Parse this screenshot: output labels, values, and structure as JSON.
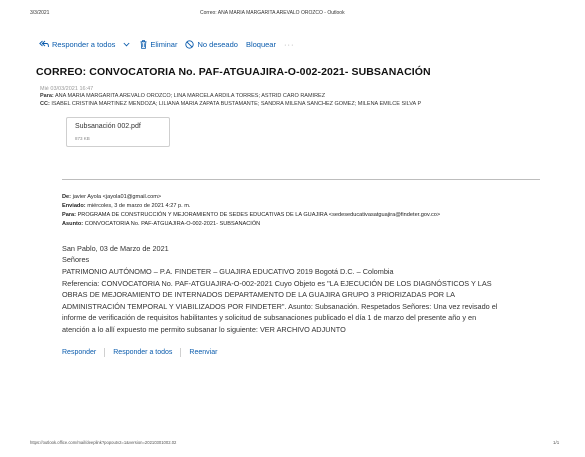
{
  "print_header": {
    "date": "3/3/2021",
    "title": "Correo: ANA MARIA MARGARITA AREVALO OROZCO - Outlook"
  },
  "toolbar": {
    "reply_all": "Responder a todos",
    "delete": "Eliminar",
    "junk": "No deseado",
    "block": "Bloquear",
    "more": "···"
  },
  "email": {
    "subject": "CORREO: CONVOCATORIA No. PAF-ATGUAJIRA-O-002-2021- SUBSANACIÓN",
    "sent_faded": "Mié 03/03/2021 16:47",
    "to_label": "Para:",
    "to_value": "ANA MARIA MARGARITA AREVALO OROZCO; LINA MARCELA ARDILA TORRES; ASTRID CARO RAMIREZ",
    "cc_label": "CC:",
    "cc_value": "ISABEL CRISTINA MARTINEZ MENDOZA; LILIANA MARIA ZAPATA BUSTAMANTE; SANDRA MILENA SANCHEZ GOMEZ; MILENA EMILCE SILVA P",
    "attachment": {
      "name": "Subsanación 002.pdf",
      "size": "873 KB"
    }
  },
  "forwarded": {
    "from_label": "De:",
    "from_value": "javier Ayola <jayola01@gmail.com>",
    "sent_label": "Enviado:",
    "sent_value": "miércoles, 3 de marzo de 2021 4:27 p. m.",
    "to_label": "Para:",
    "to_value": "PROGRAMA DE CONSTRUCCIÓN Y MEJORAMIENTO DE SEDES EDUCATIVAS DE LA GUAJIRA <sedeseducativasatguajira@findeter.gov.co>",
    "subject_label": "Asunto:",
    "subject_value": "CONVOCATORIA No. PAF-ATGUAJIRA-O-002-2021- SUBSANACIÓN"
  },
  "body": {
    "lines": [
      "San Pablo, 03 de Marzo de 2021",
      "Señores",
      "PATRIMONIO AUTÓNOMO – P.A. FINDETER – GUAJIRA EDUCATIVO 2019 Bogotá D.C. – Colombia",
      "Referencia: CONVOCATORIA No. PAF-ATGUAJIRA-O-002-2021 Cuyo Objeto es \"LA EJECUCIÓN DE LOS DIAGNÓSTICOS Y LAS",
      "OBRAS DE MEJORAMIENTO DE INTERNADOS DEPARTAMENTO DE LA GUAJIRA GRUPO 3 PRIORIZADAS POR LA",
      "ADMINISTRACIÓN TEMPORAL Y VIABILIZADOS POR FINDETER\". Asunto: Subsanación. Respetados Señores: Una vez revisado el",
      "informe de verificación de requisitos habilitantes y solicitud de subsanaciones publicado el día 1 de marzo del presente año y en",
      "atención a lo allí expuesto me permito subsanar lo siguiente:  VER ARCHIVO ADJUNTO"
    ]
  },
  "actions": {
    "reply": "Responder",
    "reply_all": "Responder a todos",
    "forward": "Reenviar"
  },
  "print_footer": {
    "url": "https://outlook.office.com/mail/deeplink?popoutv2=1&version=20210301002.02",
    "page": "1/1"
  },
  "colors": {
    "link_blue": "#0b5cad",
    "text": "#222222"
  }
}
